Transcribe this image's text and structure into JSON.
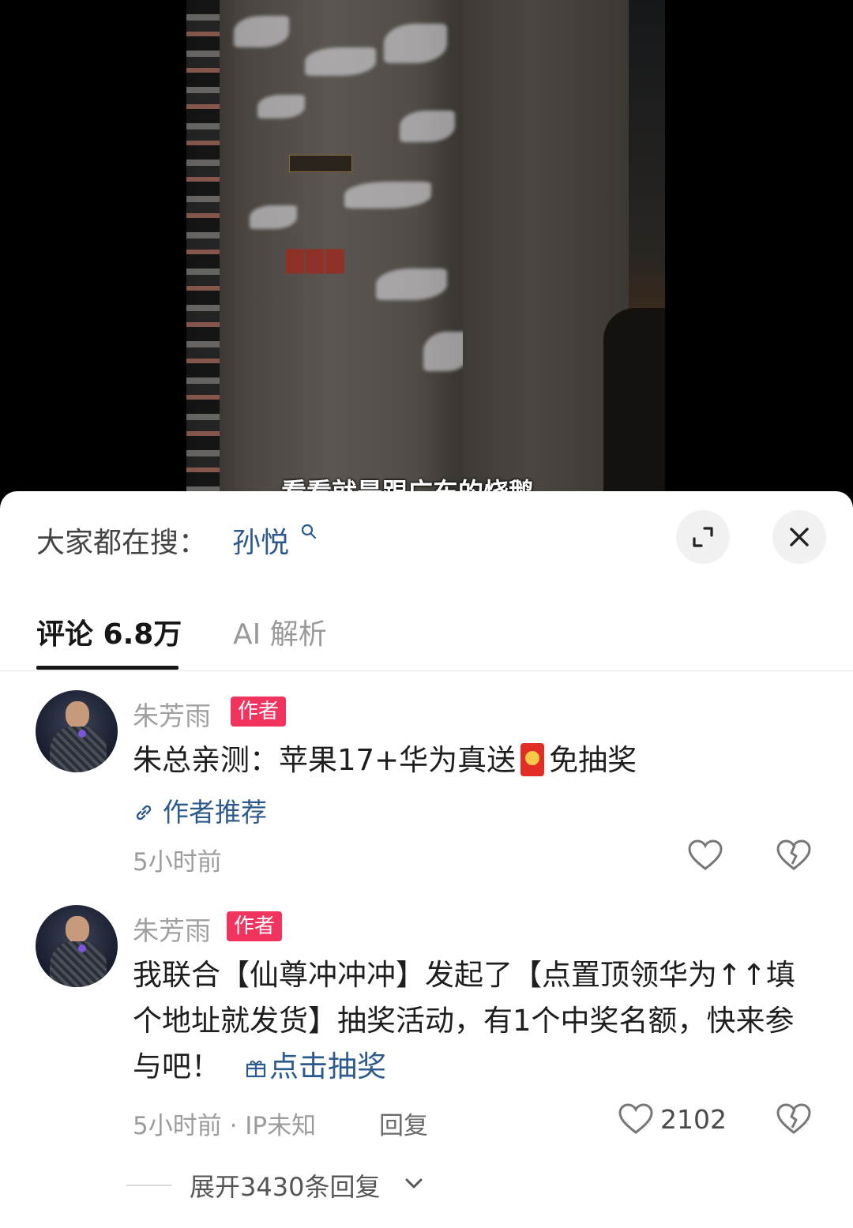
{
  "video": {
    "subtitle": "看看就是跟广东的烧鹅"
  },
  "search_bar": {
    "prefix": "大家都在搜：",
    "term": "孙悦"
  },
  "tabs": [
    {
      "label": "评论 6.8万"
    },
    {
      "label": "AI 解析"
    }
  ],
  "comments": [
    {
      "author": "朱芳雨",
      "badge": "作者",
      "text_before": "朱总亲测：苹果17+华为真送",
      "text_after": "免抽奖",
      "link": "作者推荐",
      "time": "5小时前"
    },
    {
      "author": "朱芳雨",
      "badge": "作者",
      "text": "我联合【仙尊冲冲冲】发起了【点置顶领华为↑↑填个地址就发货】抽奖活动，有1个中奖名额，快来参与吧！",
      "link": "点击抽奖",
      "time": "5小时前 · IP未知",
      "reply": "回复",
      "likes": "2102"
    }
  ],
  "expand_replies": "展开3430条回复",
  "colors": {
    "accent_link": "#2c5a8c",
    "badge_bg": "#f2335e",
    "primary_text": "#1e1e1e",
    "secondary_text": "#9c9c9c"
  }
}
